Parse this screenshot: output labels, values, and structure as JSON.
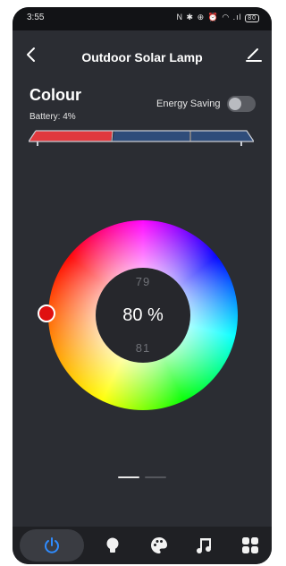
{
  "status": {
    "time": "3:55",
    "icons": "N ✱ ⊕ ⏰ ◠ .ıl",
    "battery": "80"
  },
  "header": {
    "title": "Outdoor Solar Lamp"
  },
  "mode": {
    "title": "Colour",
    "battery": "Battery: 4%"
  },
  "energy_saving": {
    "label": "Energy Saving",
    "enabled": false
  },
  "brightness": {
    "value": "80 %",
    "above": "79",
    "below": "81",
    "level_percent": 80
  },
  "panel": {
    "segments": 3,
    "active_segment": 1,
    "active_color": "#e0393e",
    "inactive_color": "#2f4c7a"
  },
  "picker": {
    "color": "#e01010"
  },
  "pager": {
    "pages": 2,
    "active": 1
  },
  "nav": {
    "items": [
      "power",
      "light",
      "palette",
      "music",
      "scenes"
    ],
    "active": "power",
    "active_color": "#2f8cff"
  }
}
